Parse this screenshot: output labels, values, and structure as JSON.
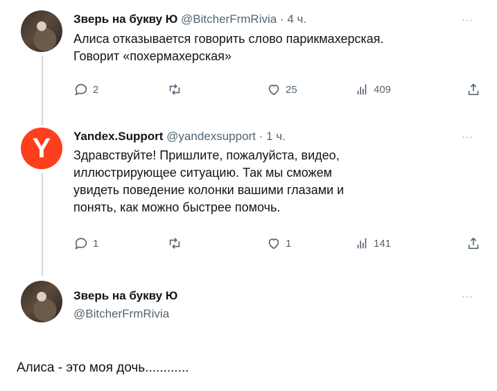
{
  "tweet1": {
    "name": "Зверь на букву Ю",
    "handle": "@BitcherFrmRivia",
    "separator": "·",
    "time": "4 ч.",
    "more": "···",
    "lines": [
      "Алиса отказывается говорить слово парикмахерская.",
      "Говорит «похермахерская»"
    ],
    "replies": "2",
    "likes": "25",
    "views": "409"
  },
  "tweet2": {
    "name": "Yandex.Support",
    "handle": "@yandexsupport",
    "separator": "·",
    "time": "1 ч.",
    "avatar_letter": "Y",
    "more": "···",
    "lines": [
      "Здравствуйте! Пришлите, пожалуйста, видео,",
      "иллюстрирующее ситуацию. Так мы сможем",
      "увидеть поведение колонки вашими глазами и",
      "понять, как можно быстрее помочь."
    ],
    "replies": "1",
    "likes": "1",
    "views": "141"
  },
  "tweet3": {
    "name": "Зверь на букву Ю",
    "handle": "@BitcherFrmRivia",
    "more": "···"
  },
  "caption": "Алиса - это моя дочь............",
  "colors": {
    "yandex_red": "#fc3f1d",
    "text": "#0f1419",
    "muted": "#536471"
  }
}
